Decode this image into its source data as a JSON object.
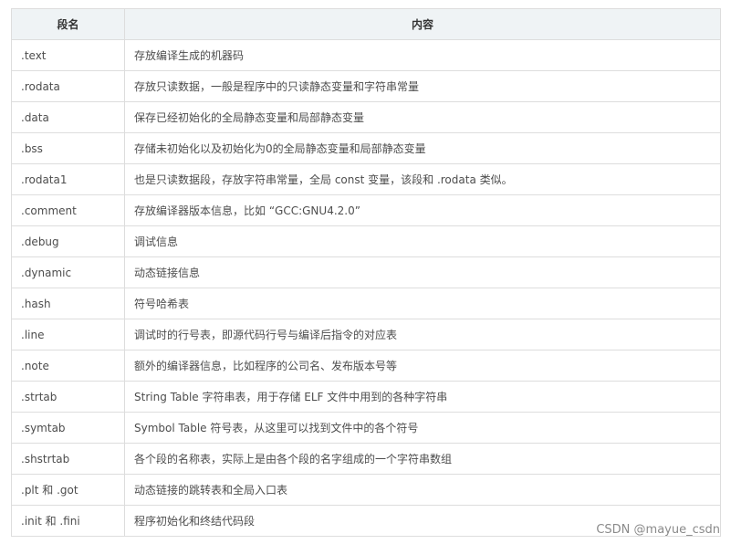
{
  "table": {
    "headers": [
      "段名",
      "内容"
    ],
    "rows": [
      {
        "name": ".text",
        "desc": "存放编译生成的机器码"
      },
      {
        "name": ".rodata",
        "desc": "存放只读数据，一般是程序中的只读静态变量和字符串常量"
      },
      {
        "name": ".data",
        "desc": "保存已经初始化的全局静态变量和局部静态变量"
      },
      {
        "name": ".bss",
        "desc": "存储未初始化以及初始化为0的全局静态变量和局部静态变量"
      },
      {
        "name": ".rodata1",
        "desc": "也是只读数据段，存放字符串常量，全局 const 变量，该段和 .rodata 类似。"
      },
      {
        "name": ".comment",
        "desc": "存放编译器版本信息，比如 “GCC:GNU4.2.0”"
      },
      {
        "name": ".debug",
        "desc": "调试信息"
      },
      {
        "name": ".dynamic",
        "desc": "动态链接信息"
      },
      {
        "name": ".hash",
        "desc": "符号哈希表"
      },
      {
        "name": ".line",
        "desc": "调试时的行号表，即源代码行号与编译后指令的对应表"
      },
      {
        "name": ".note",
        "desc": "额外的编译器信息，比如程序的公司名、发布版本号等"
      },
      {
        "name": ".strtab",
        "desc": "String Table 字符串表，用于存储 ELF 文件中用到的各种字符串"
      },
      {
        "name": ".symtab",
        "desc": "Symbol Table 符号表，从这里可以找到文件中的各个符号"
      },
      {
        "name": ".shstrtab",
        "desc": "各个段的名称表，实际上是由各个段的名字组成的一个字符串数组"
      },
      {
        "name": ".plt 和 .got",
        "desc": "动态链接的跳转表和全局入口表"
      },
      {
        "name": ".init 和 .fini",
        "desc": "程序初始化和终结代码段"
      }
    ]
  },
  "watermark": "CSDN @mayue_csdn",
  "colors": {
    "header_bg": "#eff3f5",
    "border": "#dddddd",
    "text": "#4d4d4d"
  }
}
